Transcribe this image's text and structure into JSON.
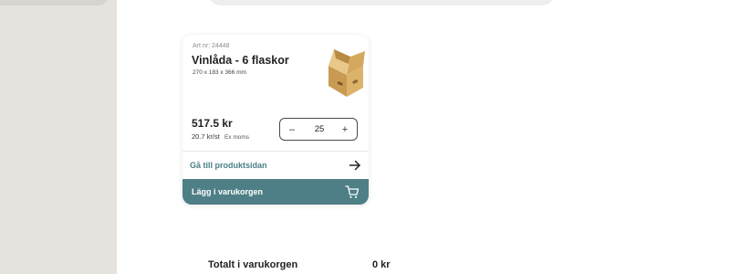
{
  "product": {
    "article_number": "Art nr: 24448",
    "title": "Vinlåda - 6 flaskor",
    "dimensions": "270 x 183 x 366 mm",
    "image_icon": "cardboard-box-icon",
    "price": "517.5 kr",
    "unit_price": "20.7 kr/st",
    "vat_note": "Ex moms",
    "quantity": "25",
    "minus_label": "–",
    "plus_label": "+",
    "product_link_label": "Gå till produktsidan",
    "add_to_cart_label": "Lägg i varukorgen"
  },
  "cart": {
    "total_label": "Totalt i varukorgen",
    "total_value": "0 kr"
  },
  "colors": {
    "accent": "#4e7f86",
    "link": "#4a8088",
    "sidebar": "#e6e2dd"
  }
}
